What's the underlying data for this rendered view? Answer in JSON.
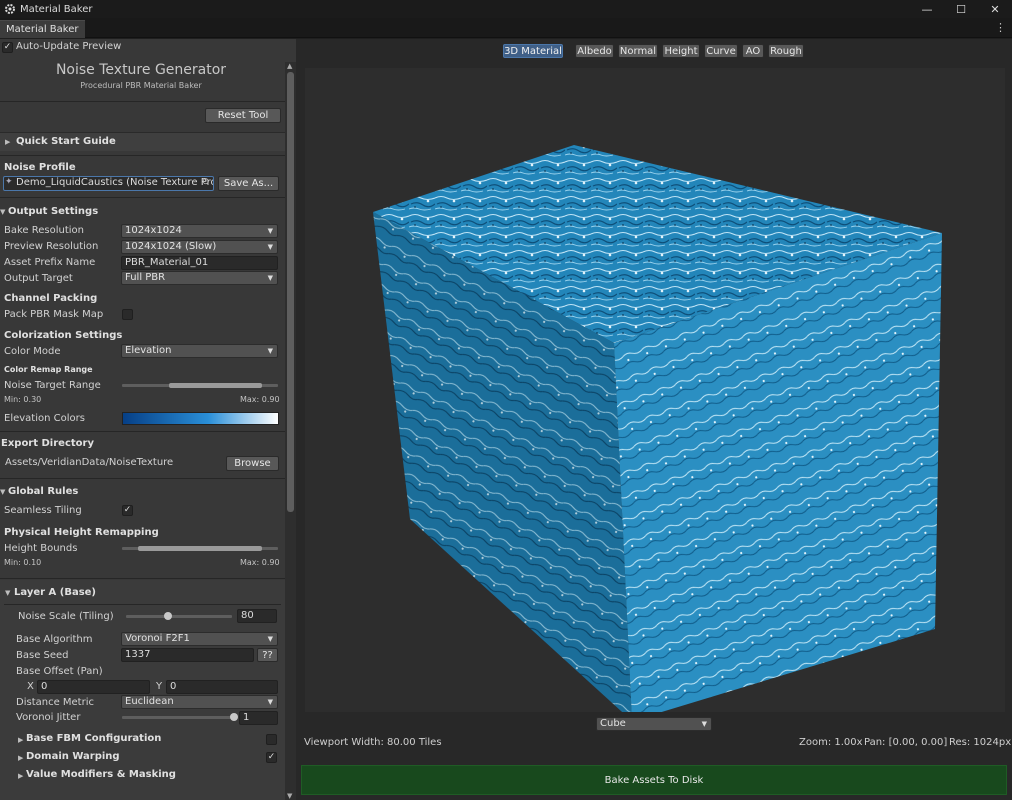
{
  "window": {
    "title": "Material Baker"
  },
  "tab": {
    "label": "Material Baker"
  },
  "auto_update": {
    "label": "Auto-Update Preview",
    "checked": true
  },
  "header": {
    "title": "Noise Texture Generator",
    "subtitle": "Procedural PBR Material Baker"
  },
  "reset_label": "Reset Tool",
  "quick_start": "Quick Start Guide",
  "noise_profile": {
    "heading": "Noise Profile",
    "value": "Demo_LiquidCaustics (Noise Texture Prof",
    "save_label": "Save As..."
  },
  "output": {
    "heading": "Output Settings",
    "bake_resolution": {
      "label": "Bake Resolution",
      "value": "1024x1024"
    },
    "preview_resolution": {
      "label": "Preview Resolution",
      "value": "1024x1024 (Slow)"
    },
    "asset_prefix": {
      "label": "Asset Prefix Name",
      "value": "PBR_Material_01"
    },
    "output_target": {
      "label": "Output Target",
      "value": "Full PBR"
    }
  },
  "channel_packing": {
    "heading": "Channel Packing",
    "pack_label": "Pack PBR Mask Map"
  },
  "colorization": {
    "heading": "Colorization Settings",
    "color_mode": {
      "label": "Color Mode",
      "value": "Elevation"
    },
    "remap_heading": "Color Remap Range",
    "target_range": {
      "label": "Noise Target Range",
      "min_text": "Min: 0.30",
      "max_text": "Max: 0.90",
      "min": 0.3,
      "max": 0.9
    },
    "elevation_label": "Elevation Colors",
    "gradient": {
      "from": "#063f86",
      "mid": "#2a8fd8",
      "to": "#ffffff"
    }
  },
  "export": {
    "heading": "Export Directory",
    "path": "Assets/VeridianData/NoiseTexture",
    "browse_label": "Browse"
  },
  "global_rules": {
    "heading": "Global Rules",
    "seamless_label": "Seamless Tiling",
    "physical_heading": "Physical Height Remapping",
    "height_bounds": {
      "label": "Height Bounds",
      "min_text": "Min: 0.10",
      "max_text": "Max: 0.90",
      "min": 0.1,
      "max": 0.9
    }
  },
  "layer_a": {
    "heading": "Layer A (Base)",
    "noise_scale": {
      "label": "Noise Scale (Tiling)",
      "value": "80",
      "fraction": 0.4
    },
    "base_algorithm": {
      "label": "Base Algorithm",
      "value": "Voronoi F2F1"
    },
    "base_seed": {
      "label": "Base Seed",
      "value": "1337",
      "button": "??"
    },
    "base_offset": {
      "label": "Base Offset (Pan)",
      "x_label": "X",
      "x_value": "0",
      "y_label": "Y",
      "y_value": "0"
    },
    "distance_metric": {
      "label": "Distance Metric",
      "value": "Euclidean"
    },
    "voronoi_jitter": {
      "label": "Voronoi Jitter",
      "value": "1",
      "fraction": 1.0
    },
    "fbm_label": "Base FBM Configuration",
    "domain_warp_label": "Domain Warping",
    "value_mod_label": "Value Modifiers & Masking"
  },
  "viewport_tabs": [
    {
      "label": "3D Material",
      "active": true
    },
    {
      "label": "Albedo",
      "active": false
    },
    {
      "label": "Normal",
      "active": false
    },
    {
      "label": "Height",
      "active": false
    },
    {
      "label": "Curve",
      "active": false
    },
    {
      "label": "AO",
      "active": false
    },
    {
      "label": "Rough",
      "active": false
    }
  ],
  "preview_shape": "Cube",
  "status": {
    "viewport_width": "Viewport Width: 80.00 Tiles",
    "zoom": "Zoom: 1.00x",
    "pan": "Pan: [0.00, 0.00]",
    "res": "Res: 1024px"
  },
  "bake_label": "Bake Assets To Disk",
  "colors": {
    "accent": "#3f5f87",
    "bake": "#18491d",
    "water": "#2a86b8"
  }
}
